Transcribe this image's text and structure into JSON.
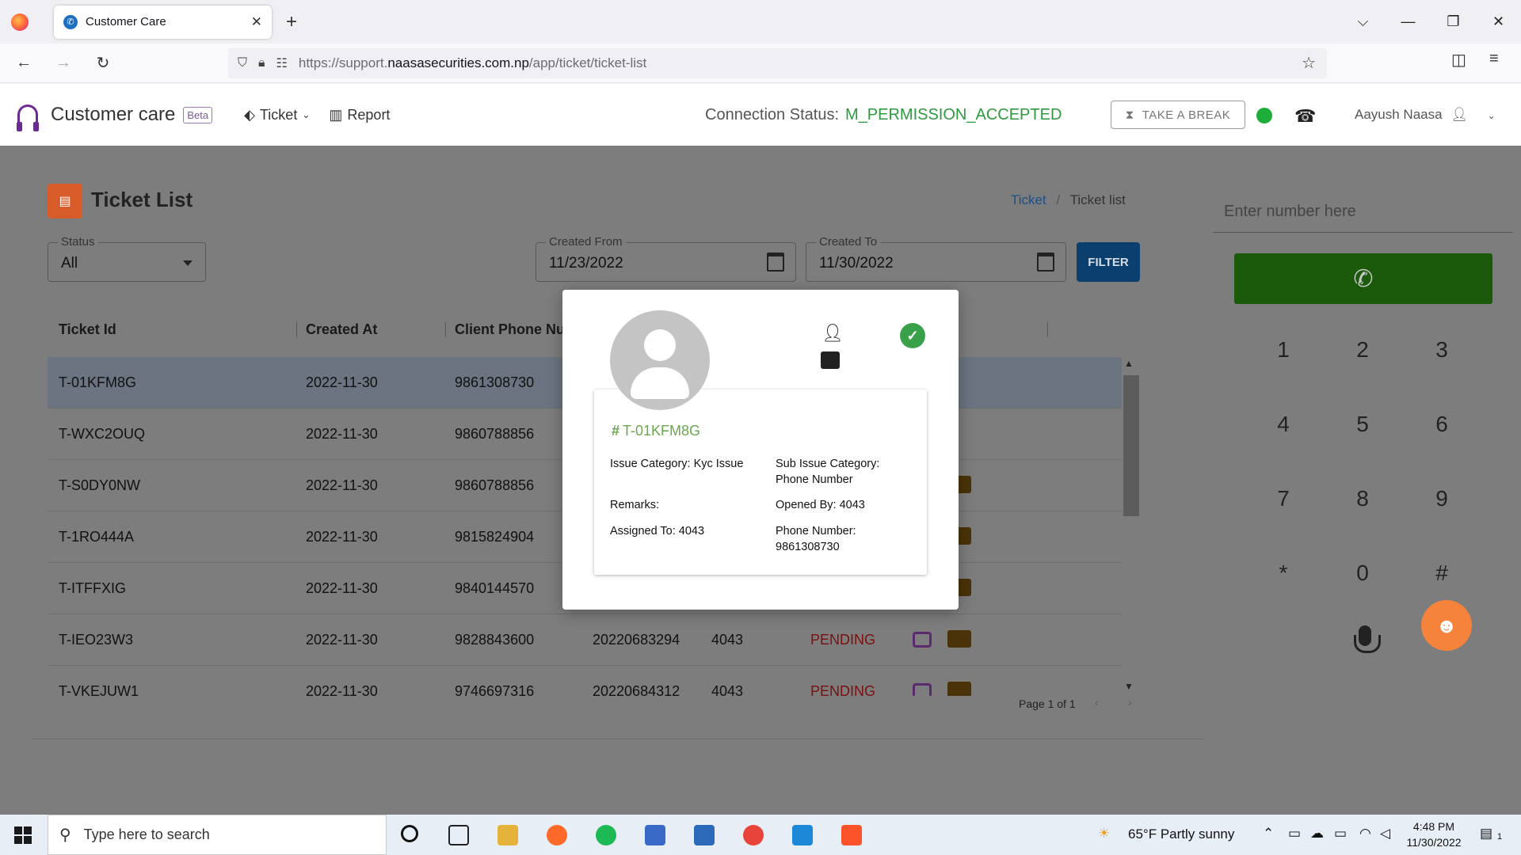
{
  "browser": {
    "tab_title": "Customer Care",
    "url_prefix": "https://support.",
    "url_host": "naasasecurities.com.np",
    "url_path": "/app/ticket/ticket-list"
  },
  "header": {
    "brand": "Customer care",
    "beta": "Beta",
    "menu_ticket": "Ticket",
    "menu_report": "Report",
    "conn_label": "Connection Status:",
    "conn_value": "M_PERMISSION_ACCEPTED",
    "break_label": "TAKE A BREAK",
    "user_name": "Aayush Naasa",
    "status_color": "#1fae3a"
  },
  "page": {
    "title": "Ticket List",
    "breadcrumb_root": "Ticket",
    "breadcrumb_sep": "/",
    "breadcrumb_current": "Ticket list"
  },
  "filters": {
    "status_label": "Status",
    "status_value": "All",
    "from_label": "Created From",
    "from_value": "11/23/2022",
    "to_label": "Created To",
    "to_value": "11/30/2022",
    "filter_label": "FILTER"
  },
  "table": {
    "columns": [
      "Ticket Id",
      "Created At",
      "Client Phone Num"
    ],
    "rows": [
      {
        "id": "T-01KFM8G",
        "created": "2022-11-30",
        "phone": "9861308730",
        "ref": "",
        "opened": "",
        "status": ""
      },
      {
        "id": "T-WXC2OUQ",
        "created": "2022-11-30",
        "phone": "9860788856",
        "ref": "",
        "opened": "",
        "status": ""
      },
      {
        "id": "T-S0DY0NW",
        "created": "2022-11-30",
        "phone": "9860788856",
        "ref": "",
        "opened": "",
        "status": ""
      },
      {
        "id": "T-1RO444A",
        "created": "2022-11-30",
        "phone": "9815824904",
        "ref": "",
        "opened": "",
        "status": ""
      },
      {
        "id": "T-ITFFXIG",
        "created": "2022-11-30",
        "phone": "9840144570",
        "ref": "",
        "opened": "",
        "status": ""
      },
      {
        "id": "T-IEO23W3",
        "created": "2022-11-30",
        "phone": "9828843600",
        "ref": "20220683294",
        "opened": "4043",
        "status": "PENDING"
      },
      {
        "id": "T-VKEJUW1",
        "created": "2022-11-30",
        "phone": "9746697316",
        "ref": "20220684312",
        "opened": "4043",
        "status": "PENDING"
      }
    ],
    "page_info": "Page 1 of 1"
  },
  "dialer": {
    "placeholder": "Enter number here",
    "keys": [
      "1",
      "2",
      "3",
      "4",
      "5",
      "6",
      "7",
      "8",
      "9",
      "*",
      "0",
      "#"
    ]
  },
  "modal": {
    "ticket_id": "T-01KFM8G",
    "issue_category": "Issue Category: Kyc Issue",
    "sub_issue_label": "Sub Issue Category:",
    "sub_issue_value": "Phone Number",
    "remarks": "Remarks:",
    "opened_by": "Opened By: 4043",
    "assigned_to": "Assigned To: 4043",
    "phone_label": "Phone Number:",
    "phone_value": "9861308730"
  },
  "taskbar": {
    "search_placeholder": "Type here to search",
    "weather": "65°F  Partly sunny",
    "time": "4:48 PM",
    "date": "11/30/2022",
    "notif_count": "1"
  }
}
